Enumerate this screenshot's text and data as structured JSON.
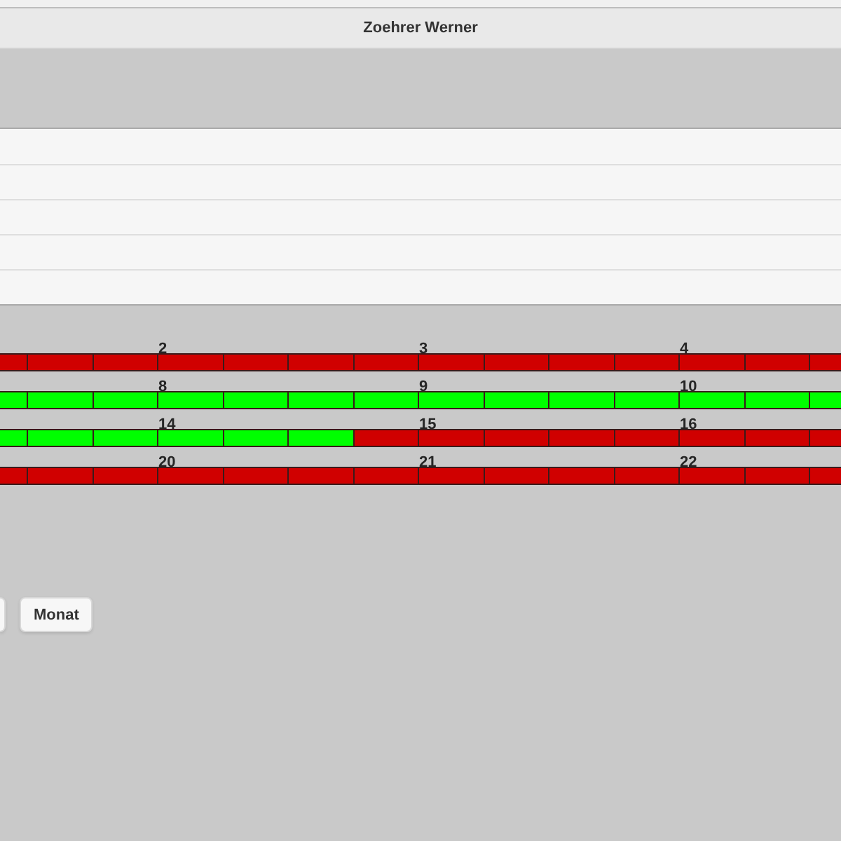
{
  "header": {
    "title": "Zoehrer Werner"
  },
  "timeline": {
    "rows": [
      {
        "days": [
          {
            "slots": [
              {
                "color": "#d00000"
              },
              {
                "color": "#d00000"
              },
              {
                "color": "#d00000"
              }
            ]
          },
          {
            "label": "2",
            "slots": [
              {
                "color": "#d00000"
              },
              {
                "color": "#d00000"
              },
              {
                "color": "#d00000"
              },
              {
                "color": "#d00000"
              }
            ]
          },
          {
            "label": "3",
            "slots": [
              {
                "color": "#d00000"
              },
              {
                "color": "#d00000"
              },
              {
                "color": "#d00000"
              },
              {
                "color": "#d00000"
              }
            ]
          },
          {
            "label": "4",
            "slots": [
              {
                "color": "#d00000"
              },
              {
                "color": "#d00000"
              },
              {
                "color": "#d00000"
              }
            ]
          }
        ]
      },
      {
        "days": [
          {
            "slots": [
              {
                "color": "#00ff00"
              },
              {
                "color": "#00ff00"
              },
              {
                "color": "#00ff00"
              }
            ]
          },
          {
            "label": "8",
            "slots": [
              {
                "color": "#00ff00"
              },
              {
                "color": "#00ff00"
              },
              {
                "color": "#00ff00"
              },
              {
                "color": "#00ff00"
              }
            ]
          },
          {
            "label": "9",
            "slots": [
              {
                "color": "#00ff00"
              },
              {
                "color": "#00ff00"
              },
              {
                "color": "#00ff00"
              },
              {
                "color": "#00ff00"
              }
            ]
          },
          {
            "label": "10",
            "slots": [
              {
                "color": "#00ff00"
              },
              {
                "color": "#00ff00"
              },
              {
                "color": "#00ff00"
              }
            ]
          }
        ]
      },
      {
        "days": [
          {
            "slots": [
              {
                "color": "#00ff00"
              },
              {
                "color": "#00ff00"
              },
              {
                "color": "#00ff00"
              }
            ]
          },
          {
            "label": "14",
            "slots": [
              {
                "color": "#00ff00"
              },
              {
                "color": "#00ff00"
              },
              {
                "color": "#00ff00"
              },
              {
                "color": "#d00000"
              }
            ]
          },
          {
            "label": "15",
            "slots": [
              {
                "color": "#d00000"
              },
              {
                "color": "#d00000"
              },
              {
                "color": "#d00000"
              },
              {
                "color": "#d00000"
              }
            ]
          },
          {
            "label": "16",
            "slots": [
              {
                "color": "#d00000"
              },
              {
                "color": "#d00000"
              },
              {
                "color": "#d00000"
              }
            ]
          }
        ]
      },
      {
        "days": [
          {
            "slots": [
              {
                "color": "#d00000"
              },
              {
                "color": "#d00000"
              },
              {
                "color": "#d00000"
              }
            ]
          },
          {
            "label": "20",
            "slots": [
              {
                "color": "#d00000"
              },
              {
                "color": "#d00000"
              },
              {
                "color": "#d00000"
              },
              {
                "color": "#d00000"
              }
            ]
          },
          {
            "label": "21",
            "slots": [
              {
                "color": "#d00000"
              },
              {
                "color": "#d00000"
              },
              {
                "color": "#d00000"
              },
              {
                "color": "#d00000"
              }
            ]
          },
          {
            "label": "22",
            "slots": [
              {
                "color": "#d00000"
              },
              {
                "color": "#d00000"
              },
              {
                "color": "#d00000"
              }
            ]
          }
        ]
      }
    ]
  },
  "buttons": [
    {
      "kind": "clipped"
    },
    {
      "kind": "text",
      "label": "Monat"
    }
  ]
}
